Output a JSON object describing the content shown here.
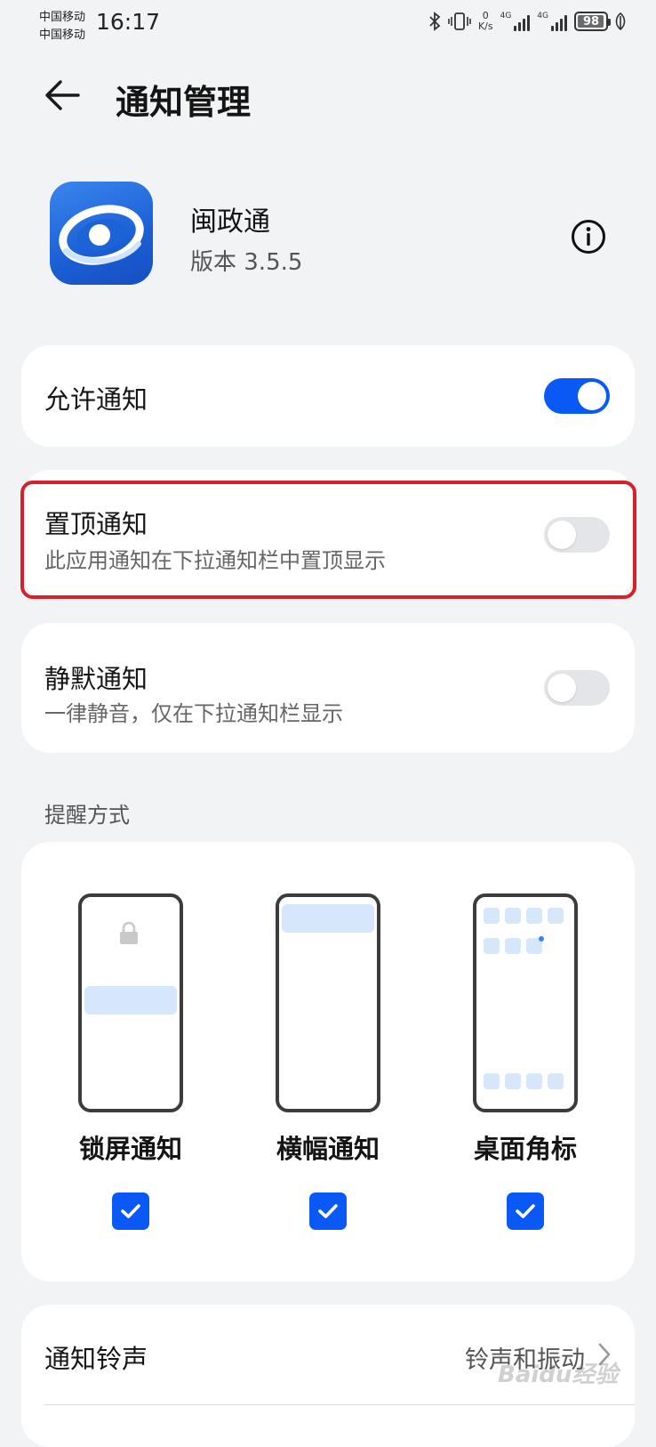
{
  "status_bar": {
    "carrier1": "中国移动",
    "carrier2": "中国移动",
    "time": "16:17",
    "net_speed_value": "0",
    "net_speed_unit": "K/s",
    "signal1_label": "4G",
    "signal2_label": "4G",
    "battery": "98",
    "battery_level": 0.98
  },
  "header": {
    "title": "通知管理"
  },
  "app": {
    "name": "闽政通",
    "version": "版本 3.5.5"
  },
  "settings": {
    "allow": {
      "title": "允许通知",
      "enabled": true
    },
    "pinned": {
      "title": "置顶通知",
      "subtitle": "此应用通知在下拉通知栏中置顶显示",
      "enabled": false
    },
    "silent": {
      "title": "静默通知",
      "subtitle": "一律静音，仅在下拉通知栏显示",
      "enabled": false
    }
  },
  "reminder": {
    "section_label": "提醒方式",
    "modes": [
      {
        "label": "锁屏通知",
        "checked": true
      },
      {
        "label": "横幅通知",
        "checked": true
      },
      {
        "label": "桌面角标",
        "checked": true
      }
    ]
  },
  "ringtone": {
    "title": "通知铃声",
    "value": "铃声和振动"
  },
  "watermark": "Baidu经验",
  "colors": {
    "accent": "#0a59f7",
    "background": "#f1f3f5",
    "highlight": "#d8202a",
    "illustration": "#d6e6fb"
  }
}
